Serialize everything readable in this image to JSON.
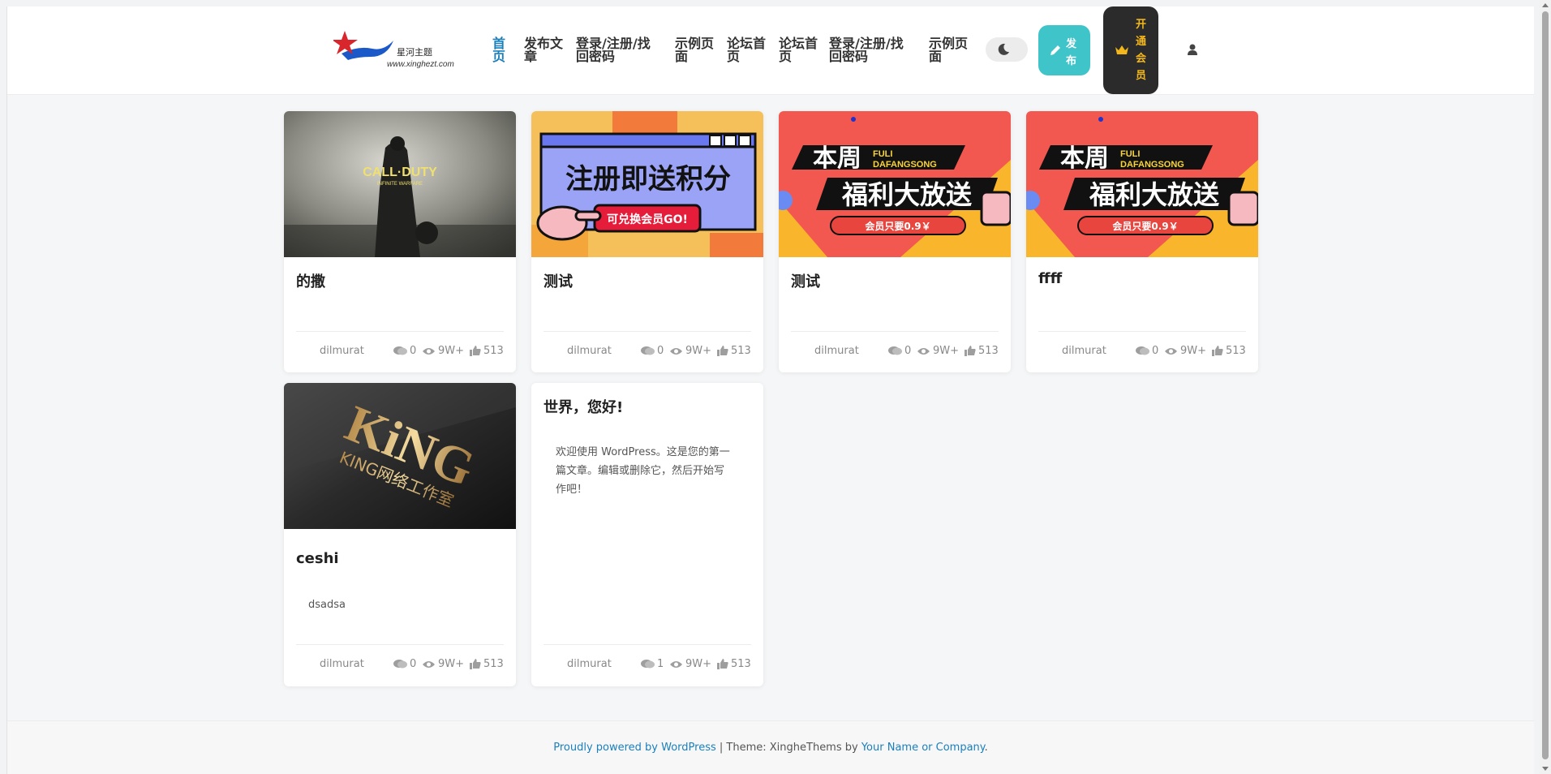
{
  "header": {
    "logo_name": "星河主题",
    "logo_url": "www.xinghezt.com",
    "nav": [
      {
        "label": "首页",
        "active": true
      },
      {
        "label": "发布文章"
      },
      {
        "label": "登录/注册/找回密码"
      },
      {
        "label": "示例页面"
      },
      {
        "label": "论坛首页"
      },
      {
        "label": "论坛首页"
      },
      {
        "label": "登录/注册/找回密码"
      },
      {
        "label": "示例页面"
      }
    ],
    "theme_toggle_icon": "moon-icon",
    "publish_label": "发布",
    "vip_label": "开通会员",
    "user_icon": "user-icon"
  },
  "thumbs": {
    "cod_title": "CALL·DUTY",
    "cod_subtitle": "INFINITE WARFARE",
    "register_headline": "注册即送积分",
    "register_button": "可兑换会员GO!",
    "fuli_big1": "本周",
    "fuli_latin1": "FULI",
    "fuli_latin2": "DAFANGSONG",
    "fuli_big2": "福利大放送",
    "fuli_pill": "会员只要0.9￥",
    "king_logo": "KiNG",
    "king_sub": "KING网络工作室"
  },
  "posts": [
    {
      "title": "的撒",
      "excerpt": "",
      "author": "dilmurat",
      "comments": "0",
      "views": "9W+",
      "likes": "513",
      "thumb": "cod"
    },
    {
      "title": "测试",
      "excerpt": "",
      "author": "dilmurat",
      "comments": "0",
      "views": "9W+",
      "likes": "513",
      "thumb": "register"
    },
    {
      "title": "测试",
      "excerpt": "",
      "author": "dilmurat",
      "comments": "0",
      "views": "9W+",
      "likes": "513",
      "thumb": "fuli"
    },
    {
      "title": "ffff",
      "excerpt": "",
      "author": "dilmurat",
      "comments": "0",
      "views": "9W+",
      "likes": "513",
      "thumb": "fuli"
    },
    {
      "title": "ceshi",
      "excerpt": "dsadsa",
      "author": "dilmurat",
      "comments": "0",
      "views": "9W+",
      "likes": "513",
      "thumb": "king"
    },
    {
      "title": "世界，您好!",
      "excerpt": "欢迎使用 WordPress。这是您的第一篇文章。编辑或删除它，然后开始写作吧！",
      "author": "dilmurat",
      "comments": "1",
      "views": "9W+",
      "likes": "513",
      "thumb": ""
    }
  ],
  "footer": {
    "powered": "Proudly powered by WordPress",
    "sep": " | Theme: XingheThems by ",
    "company": "Your Name or Company",
    "end": "."
  },
  "colors": {
    "accent": "#1a7fbd",
    "publish_bg": "#3fc4c9",
    "vip_bg": "#2b2b2b",
    "vip_text": "#f3b71b"
  }
}
